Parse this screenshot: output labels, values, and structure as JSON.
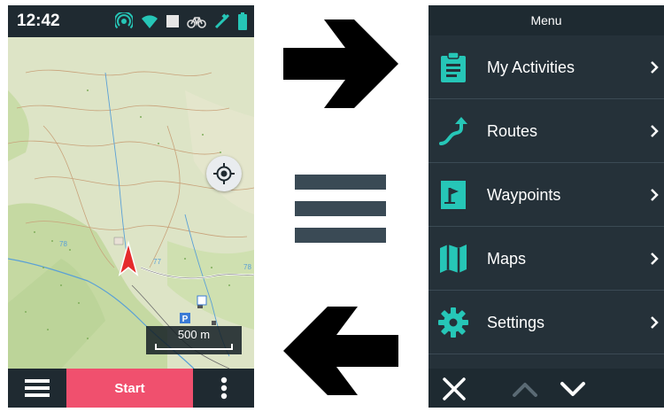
{
  "status_bar": {
    "time": "12:42",
    "icons": [
      "gps-signal-icon",
      "wifi-icon",
      "square-icon",
      "bike-icon",
      "satellite-icon",
      "battery-icon"
    ]
  },
  "map": {
    "scale_label": "500 m",
    "locate_icon": "crosshair-icon",
    "position_icon": "red-arrow-icon",
    "labels": [
      "78",
      "77",
      "78"
    ]
  },
  "bottom_bar": {
    "menu_icon": "hamburger-icon",
    "start_label": "Start",
    "more_icon": "more-vertical-icon",
    "start_color": "#f0506e"
  },
  "middle": {
    "top_arrow": "arrow-right-icon",
    "center_symbol": "hamburger-icon",
    "bottom_arrow": "arrow-left-icon"
  },
  "menu": {
    "title": "Menu",
    "accent_color": "#26c6b7",
    "items": [
      {
        "label": "My Activities",
        "icon": "clipboard-icon"
      },
      {
        "label": "Routes",
        "icon": "route-icon"
      },
      {
        "label": "Waypoints",
        "icon": "waypoint-flag-icon"
      },
      {
        "label": "Maps",
        "icon": "map-icon"
      },
      {
        "label": "Settings",
        "icon": "gear-icon"
      }
    ],
    "footer": {
      "close_icon": "close-icon",
      "up_icon": "chevron-up-icon",
      "down_icon": "chevron-down-icon"
    }
  }
}
